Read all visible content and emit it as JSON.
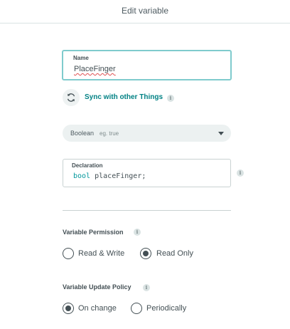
{
  "header": {
    "title": "Edit variable"
  },
  "name": {
    "label": "Name",
    "value": "PlaceFinger"
  },
  "sync": {
    "label": "Sync with other Things",
    "info": "i"
  },
  "type_select": {
    "value": "Boolean",
    "hint": "eg. true"
  },
  "declaration": {
    "label": "Declaration",
    "keyword": "bool",
    "rest": " placeFinger;",
    "info": "i"
  },
  "permission": {
    "title": "Variable Permission",
    "info": "i",
    "options": [
      {
        "label": "Read & Write",
        "checked": false
      },
      {
        "label": "Read Only",
        "checked": true
      }
    ]
  },
  "update_policy": {
    "title": "Variable Update Policy",
    "info": "i",
    "options": [
      {
        "label": "On change",
        "checked": true
      },
      {
        "label": "Periodically",
        "checked": false
      }
    ]
  },
  "colors": {
    "accent": "#008184",
    "focus_border": "#7fcbcd",
    "text": "#434f54",
    "keyword": "#00979c"
  },
  "icons": {
    "sync": "sync-icon",
    "info": "info-icon",
    "dropdown": "chevron-down-icon"
  }
}
